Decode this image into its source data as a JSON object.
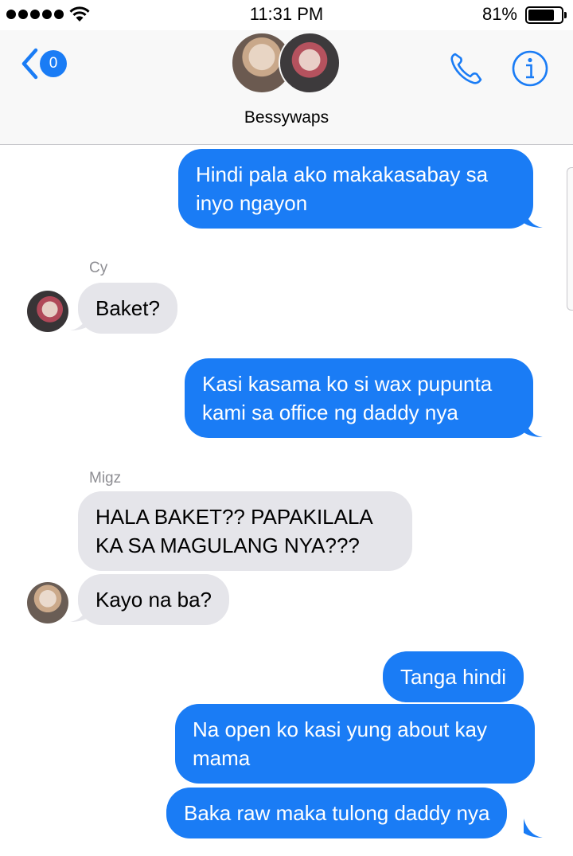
{
  "status_bar": {
    "time": "11:31 PM",
    "battery_percent": "81%",
    "signal_icon": "signal-dots-icon",
    "wifi_icon": "wifi-icon",
    "battery_icon": "battery-icon",
    "battery_level": 0.81
  },
  "header": {
    "back_badge": "0",
    "group_name": "Bessywaps",
    "call_icon": "phone-icon",
    "info_icon": "info-icon",
    "accent_color": "#1a7cf5"
  },
  "messages": [
    {
      "direction": "outgoing",
      "text": "Hindi pala ako makakasabay sa inyo ngayon"
    },
    {
      "direction": "incoming",
      "sender": "Cy",
      "text": "Baket?"
    },
    {
      "direction": "outgoing",
      "text": "Kasi kasama ko si wax pupunta kami sa office ng daddy nya"
    },
    {
      "direction": "incoming",
      "sender": "Migz",
      "text": "HALA BAKET?? PAPAKILALA KA SA MAGULANG NYA???"
    },
    {
      "direction": "incoming",
      "text": "Kayo na ba?"
    },
    {
      "direction": "outgoing",
      "text": "Tanga hindi"
    },
    {
      "direction": "outgoing",
      "text": "Na open ko kasi yung about kay mama"
    },
    {
      "direction": "outgoing",
      "text": "Baka raw maka tulong daddy nya"
    }
  ],
  "colors": {
    "outgoing_bubble": "#1a7cf5",
    "incoming_bubble": "#e5e5ea",
    "sender_label": "#8e8e93"
  }
}
